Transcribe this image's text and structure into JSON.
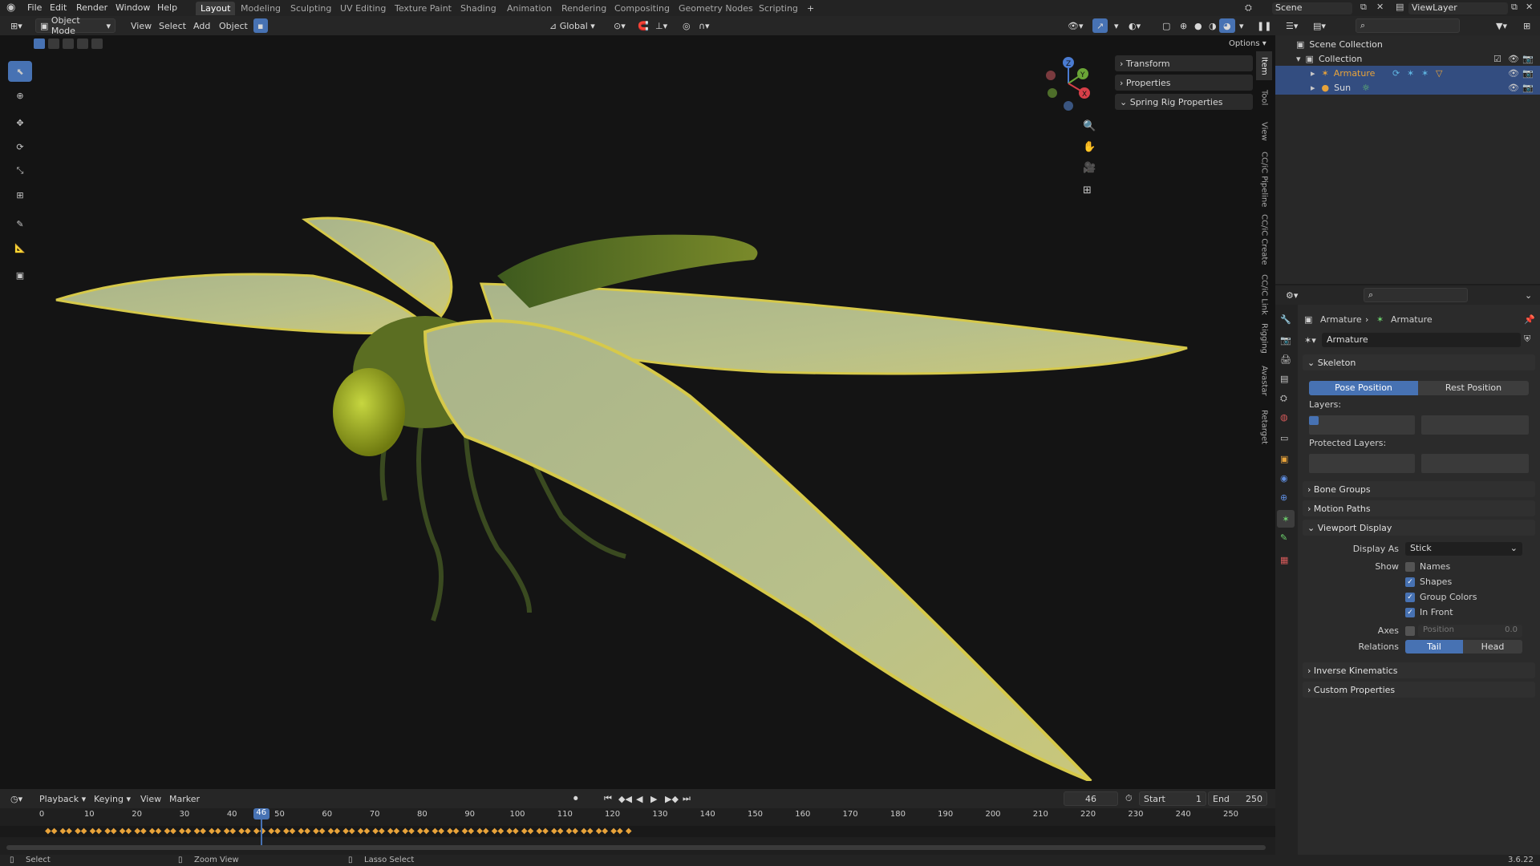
{
  "topbar": {
    "menus": [
      "File",
      "Edit",
      "Render",
      "Window",
      "Help"
    ],
    "workspaces": [
      "Layout",
      "Modeling",
      "Sculpting",
      "UV Editing",
      "Texture Paint",
      "Shading",
      "Animation",
      "Rendering",
      "Compositing",
      "Geometry Nodes",
      "Scripting"
    ],
    "active_workspace": "Layout",
    "add_tab": "+",
    "scene": "Scene",
    "view_layer": "ViewLayer"
  },
  "viewport_header": {
    "mode": "Object Mode",
    "view": "View",
    "select": "Select",
    "add": "Add",
    "object": "Object",
    "transform_orientation": "Global",
    "options": "Options"
  },
  "npanel": {
    "sections": [
      "Transform",
      "Properties",
      "Spring Rig Properties"
    ],
    "tabs": [
      "Item",
      "Tool",
      "View",
      "CC/iC Pipeline",
      "CC/iC Create",
      "CC/iC Link",
      "Rigging",
      "Avastar",
      "Retarget"
    ]
  },
  "gizmo": {
    "x": "X",
    "y": "Y",
    "z": "Z"
  },
  "timeline": {
    "playback": "Playback",
    "keying": "Keying",
    "view": "View",
    "marker": "Marker",
    "current_frame": "46",
    "start_label": "Start",
    "start": "1",
    "end_label": "End",
    "end": "250",
    "ticks": [
      "0",
      "10",
      "20",
      "30",
      "40",
      "50",
      "60",
      "70",
      "80",
      "90",
      "100",
      "110",
      "120",
      "130",
      "140",
      "150",
      "160",
      "170",
      "180",
      "190",
      "200",
      "210",
      "220",
      "230",
      "240",
      "250"
    ]
  },
  "statusbar": {
    "select": "Select",
    "zoom": "Zoom View",
    "lasso": "Lasso Select",
    "version": "3.6.22"
  },
  "outliner": {
    "scene_collection": "Scene Collection",
    "collection": "Collection",
    "armature": "Armature",
    "sun": "Sun"
  },
  "properties": {
    "breadcrumb_object": "Armature",
    "breadcrumb_data": "Armature",
    "data_name": "Armature",
    "skeleton": "Skeleton",
    "pose_position": "Pose Position",
    "rest_position": "Rest Position",
    "layers": "Layers:",
    "protected_layers": "Protected Layers:",
    "bone_groups": "Bone Groups",
    "motion_paths": "Motion Paths",
    "viewport_display": "Viewport Display",
    "display_as_label": "Display As",
    "display_as": "Stick",
    "show_label": "Show",
    "names": "Names",
    "shapes": "Shapes",
    "group_colors": "Group Colors",
    "in_front": "In Front",
    "axes_label": "Axes",
    "position": "Position",
    "position_value": "0.0",
    "relations_label": "Relations",
    "tail": "Tail",
    "head": "Head",
    "inverse_kinematics": "Inverse Kinematics",
    "custom_properties": "Custom Properties",
    "checks": {
      "names": false,
      "shapes": true,
      "group_colors": true,
      "in_front": true,
      "axes": false
    }
  },
  "colors": {
    "accent": "#4772b3",
    "selection": "#334d80",
    "keyframe": "#e8a33a",
    "playhead": "#4772b3"
  }
}
